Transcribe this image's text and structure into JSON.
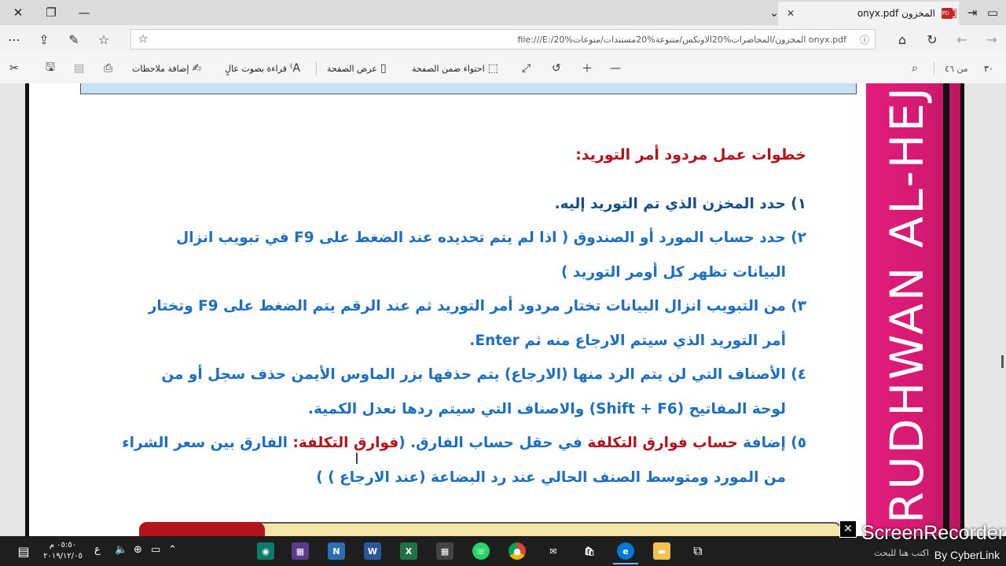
{
  "tab": {
    "title": "المخزون onyx.pdf",
    "badge": "PDF"
  },
  "address": {
    "url": "file:///E:/20%المخزون/المحاضرات%20الاونكس/متنوعة%20مستندات/منوعات onyx.pdf"
  },
  "pdf_toolbar": {
    "page_current": "٣٠",
    "page_total": "من ٤٦",
    "fit_page_label": "احتواء ضمن الصفحة",
    "page_view_label": "عرض الصفحة",
    "read_aloud_label": "قراءة بصوت عالٍ",
    "add_notes_label": "إضافة ملاحظات"
  },
  "document": {
    "heading": "خطوات عمل مردود أمر التوريد:",
    "lines": [
      "١) حدد المخزن الذي تم التوريد إليه.",
      "٢) حدد حساب المورد أو الصندوق ( اذا لم يتم تحديده عند الضغط على F9 في تبويب انزال",
      "البيانات تظهر كل أومر التوريد )",
      "٣) من التبويب انزال البيانات تختار مردود أمر التوريد ثم عند الرقم يتم الضغط على F9 وتختار",
      "أمر التوريد الذي سيتم الارجاع منه ثم Enter.",
      "٤) الأصناف التي لن يتم الرد منها (الارجاع) يتم حذفها بزر الماوس الأيمن حذف سجل أو من",
      "لوحة المفاتيح (Shift + F6) والاصناف التي سيتم ردها نعدل الكمية."
    ],
    "line5": {
      "p1": "٥) إضافة ",
      "p2": "حساب فوارق التكلفة",
      "p3": " في حقل حساب الفارق. (",
      "p4": "فوارق التكلفة:",
      "p5": " الفارق بين سعر الشراء"
    },
    "line6": "من المورد ومتوسط الصنف الحالي عند رد البضاعة (عند الارجاع ) )",
    "sidebar_text": "RUDHWAN AL-HEJRI — O"
  },
  "taskbar": {
    "time": "٠٥:٥٠ م",
    "date": "٢٠١٩/١٢/٠٥",
    "lang": "ع",
    "search_hint": "اكتب هنا للبحث"
  },
  "recorder": {
    "title": "ScreenRecorder",
    "by": "By CyberLink"
  },
  "colors": {
    "red": "#b3141c",
    "blue": "#1f6fbf",
    "sidebar": "#e31c7a"
  }
}
